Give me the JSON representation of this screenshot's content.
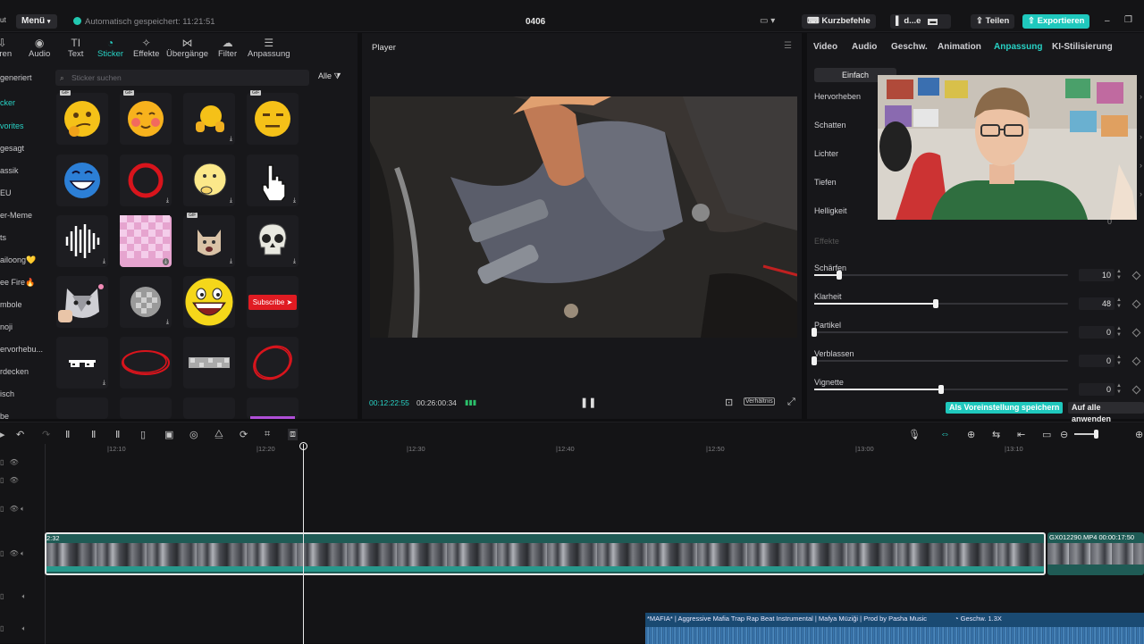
{
  "header": {
    "menu_label": "Menü",
    "autosave_text": "Automatisch gespeichert: 11:21:51",
    "project_title": "0406",
    "shortcuts_label": "Kurzbefehle",
    "user_label": "d...e",
    "share_label": "Teilen",
    "export_label": "Exportieren"
  },
  "left_toolbar": [
    {
      "label": "ieren",
      "icon": "import-icon"
    },
    {
      "label": "Audio",
      "icon": "audio-icon"
    },
    {
      "label": "Text",
      "icon": "text-icon"
    },
    {
      "label": "Sticker",
      "icon": "sticker-icon",
      "active": true
    },
    {
      "label": "Effekte",
      "icon": "effects-icon"
    },
    {
      "label": "Übergänge",
      "icon": "transitions-icon"
    },
    {
      "label": "Filter",
      "icon": "filter-icon"
    },
    {
      "label": "Anpassung",
      "icon": "adjust-icon"
    }
  ],
  "categories": [
    "generiert",
    "cker",
    "vorites",
    "gesagt",
    "assik",
    "EU",
    "er-Meme",
    "ts",
    "ailoong💛",
    "ee Fire🔥",
    "mbole",
    "noji",
    "ervorhebu...",
    "rdecken",
    "isch",
    "be"
  ],
  "active_category": "cker",
  "search": {
    "placeholder": "Sticker suchen",
    "filter_label": "Alle"
  },
  "stickers": [
    "thinking-emoji",
    "blushing-emoji",
    "thumbs-up-emoji",
    "neutral-face-emoji",
    "laughing-emoji",
    "red-ring",
    "pondering-emoji",
    "pointer-hand",
    "soundwave",
    "pink-checker",
    "crying-cat",
    "skull",
    "cat-meme",
    "pixel-blur",
    "epic-face",
    "subscribe-button",
    "pixel-sunglasses",
    "red-scribble-ellipse",
    "blur-bar",
    "red-scribble-circle"
  ],
  "subscribe_text": "Subscribe",
  "player": {
    "title": "Player",
    "current_time": "00:12:22:55",
    "total_time": "00:26:00:34",
    "ratio_label": "Verhältnis"
  },
  "right_tabs": [
    "Video",
    "Audio",
    "Geschw.",
    "Animation",
    "Anpassung",
    "KI-Stilisierung"
  ],
  "active_right_tab": "Anpassung",
  "mode_label": "Einfach",
  "upper_params": [
    "Hervorheben",
    "Schatten",
    "Lichter",
    "Tiefen",
    "Helligkeit"
  ],
  "brightness_value": "0",
  "effects_heading": "Effekte",
  "params": [
    {
      "label": "Schärfen",
      "value": "10",
      "fraction": 0.1
    },
    {
      "label": "Klarheit",
      "value": "48",
      "fraction": 0.48
    },
    {
      "label": "Partikel",
      "value": "0",
      "fraction": 0.0
    },
    {
      "label": "Verblassen",
      "value": "0",
      "fraction": 0.0
    },
    {
      "label": "Vignette",
      "value": "0",
      "fraction": 0.5
    }
  ],
  "save_preset_label": "Als Voreinstellung speichern",
  "apply_all_label": "Auf alle anwenden",
  "timeline": {
    "ruler_labels": [
      "|12:10",
      "|12:20",
      "|12:30",
      "|12:40",
      "|12:50",
      "|13:00",
      "|13:10"
    ],
    "clip_start_label": "2:32",
    "next_clip_label": "GX012290.MP4  00:00:17:50",
    "audio_clip_label": "*MAFIA* | Aggressive Mafia Trap Rap Beat Instrumental | Mafya Müziği | Prod by Pasha Music",
    "audio_speed_label": "Geschw. 1.3X"
  },
  "colors": {
    "accent": "#28d3c6",
    "export": "#1fc8bd",
    "audio": "#1c4f7a",
    "clip_border": "#3fd1c1"
  }
}
